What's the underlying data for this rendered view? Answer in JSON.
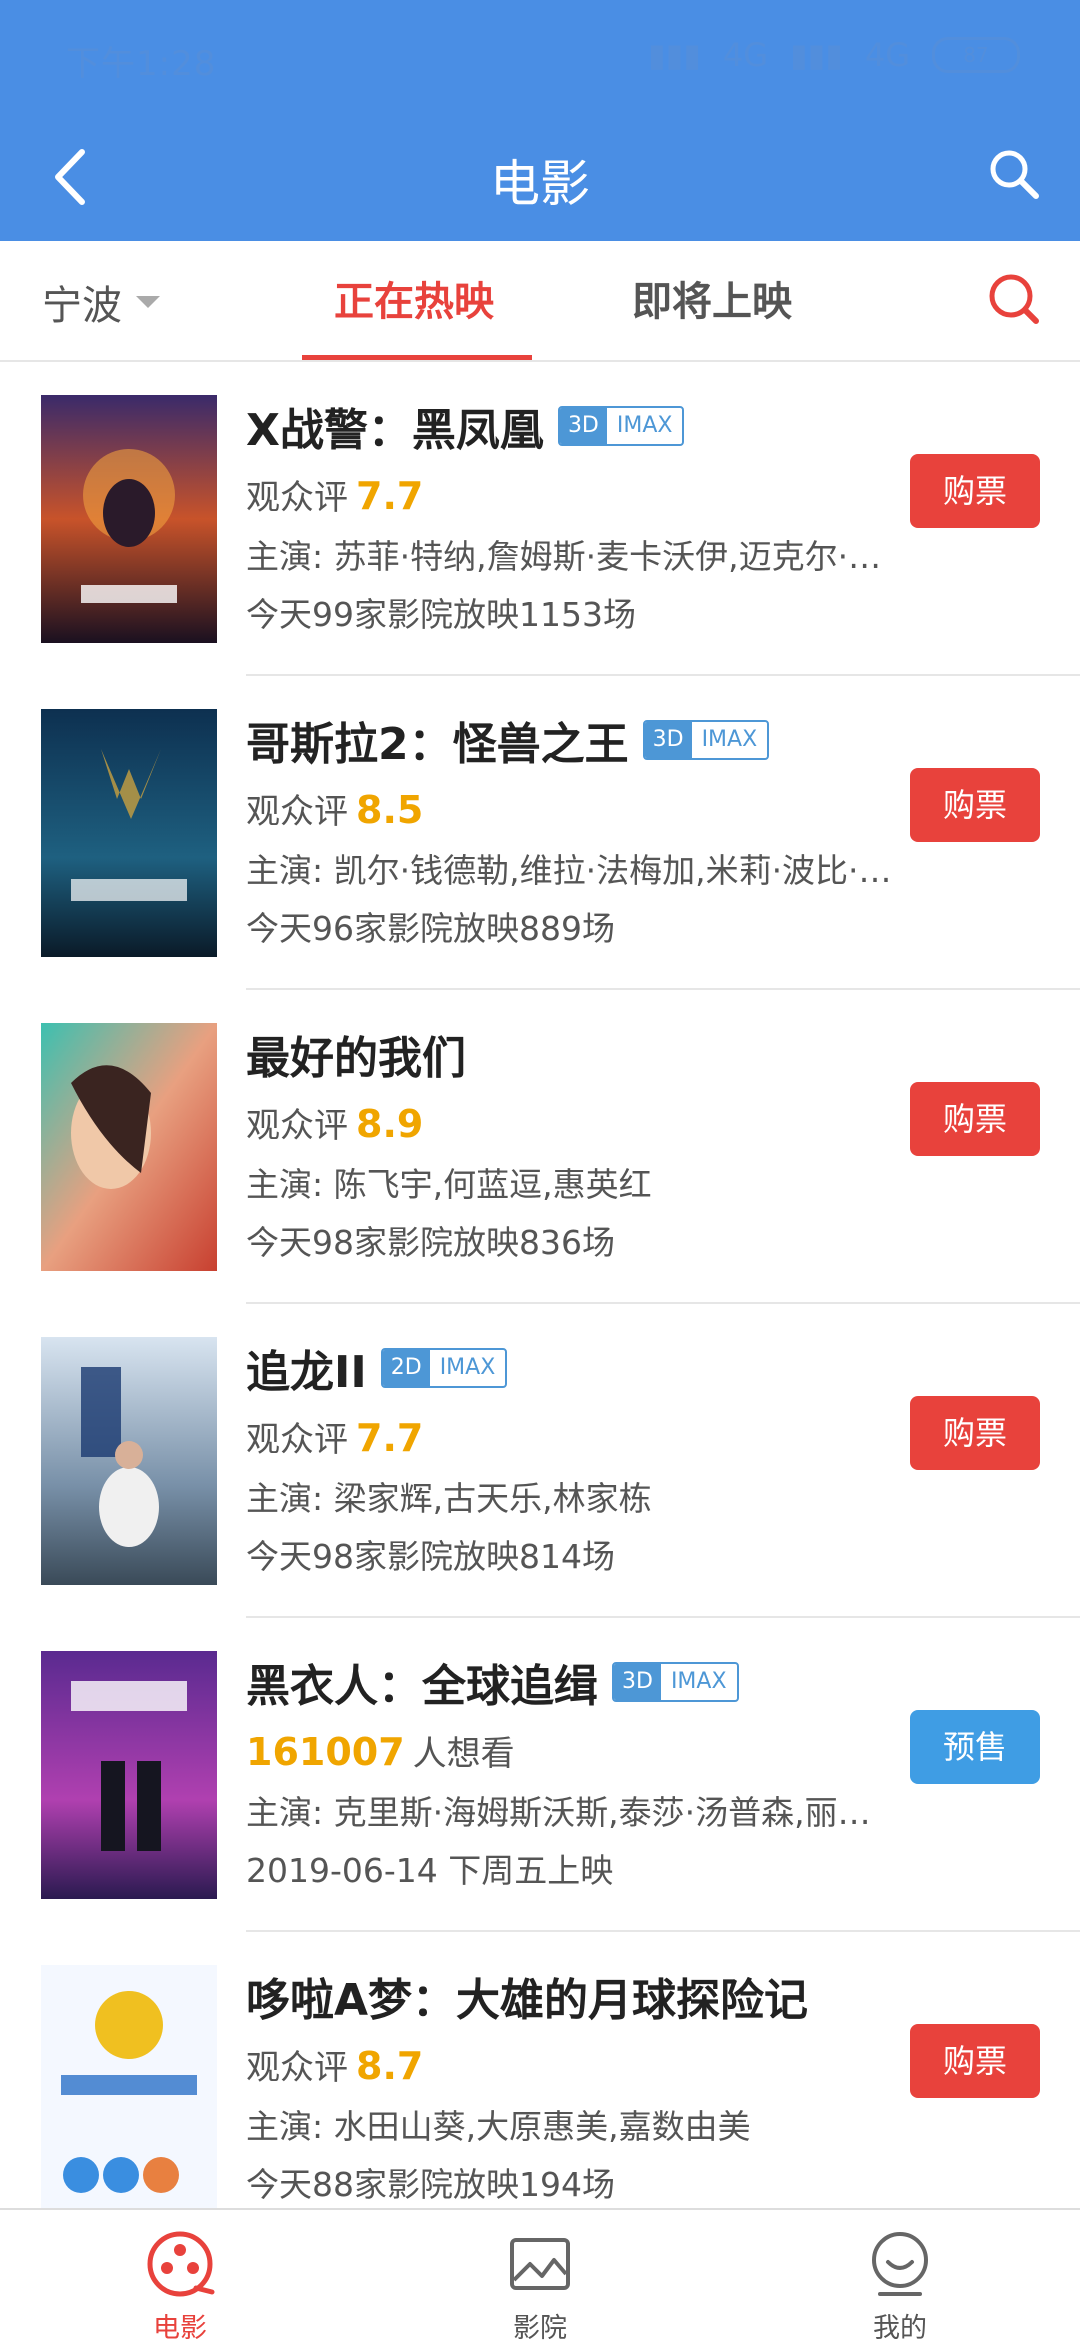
{
  "status_bar": {
    "time": "下午1:28",
    "network1": "4G",
    "network2": "4G",
    "battery": "87"
  },
  "header": {
    "title": "电影"
  },
  "tabs": {
    "city": "宁波",
    "now_playing": "正在热映",
    "coming_soon": "即将上映"
  },
  "colors": {
    "brand_blue": "#4a8ee4",
    "accent_red": "#e8423c",
    "score_orange": "#f0a500",
    "presale_blue": "#3f9de4"
  },
  "movies": [
    {
      "name": "X战警：黑凤凰",
      "dim": "3D",
      "imax": "IMAX",
      "score_label": "观众评",
      "score": "7.7",
      "cast": "主演: 苏菲·特纳,詹姆斯·麦卡沃伊,迈克尔·法斯宾德",
      "shows": "今天99家影院放映1153场",
      "button": "购票"
    },
    {
      "name": "哥斯拉2：怪兽之王",
      "dim": "3D",
      "imax": "IMAX",
      "score_label": "观众评",
      "score": "8.5",
      "cast": "主演: 凯尔·钱德勒,维拉·法梅加,米莉·波比·布朗",
      "shows": "今天96家影院放映889场",
      "button": "购票"
    },
    {
      "name": "最好的我们",
      "score_label": "观众评",
      "score": "8.9",
      "cast": "主演: 陈飞宇,何蓝逗,惠英红",
      "shows": "今天98家影院放映836场",
      "button": "购票"
    },
    {
      "name": "追龙II",
      "dim": "2D",
      "imax": "IMAX",
      "score_label": "观众评",
      "score": "7.7",
      "cast": "主演: 梁家辉,古天乐,林家栋",
      "shows": "今天98家影院放映814场",
      "button": "购票"
    },
    {
      "name": "黑衣人：全球追缉",
      "dim": "3D",
      "imax": "IMAX",
      "want_count": "161007",
      "want_label": "人想看",
      "cast": "主演: 克里斯·海姆斯沃斯,泰莎·汤普森,丽贝卡·弗格森",
      "shows": "2019-06-14 下周五上映",
      "button": "预售"
    },
    {
      "name": "哆啦A梦：大雄的月球探险记",
      "score_label": "观众评",
      "score": "8.7",
      "cast": "主演: 水田山葵,大原惠美,嘉数由美",
      "shows": "今天88家影院放映194场",
      "button": "购票"
    }
  ],
  "bottom_nav": {
    "movies": "电影",
    "cinemas": "影院",
    "mine": "我的"
  },
  "icons": {
    "back": "chevron-left-icon",
    "search": "search-icon",
    "nav_movies": "film-reel-icon",
    "nav_cinemas": "picture-frame-icon",
    "nav_mine": "smile-face-icon"
  }
}
